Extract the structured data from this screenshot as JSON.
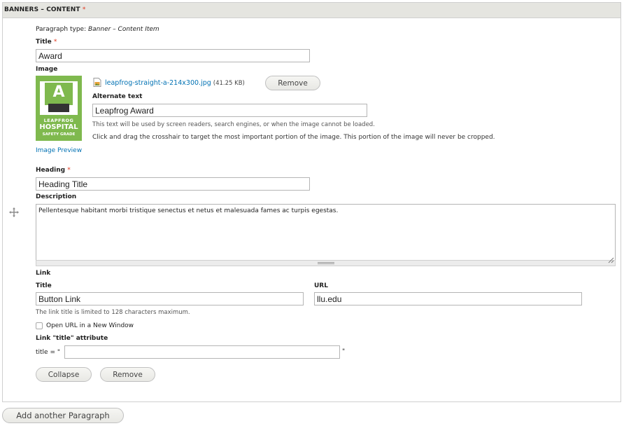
{
  "panel": {
    "title": "BANNERS – CONTENT",
    "required_mark": "*"
  },
  "paragraph_type": {
    "label": "Paragraph type:",
    "value": "Banner – Content Item"
  },
  "title_field": {
    "label": "Title",
    "required_mark": "*",
    "value": "Award"
  },
  "image_field": {
    "label": "Image",
    "file_name": "leapfrog-straight-a-214x300.jpg",
    "file_size": "(41.25 KB)",
    "remove_label": "Remove",
    "thumbnail": {
      "grade": "A",
      "line1": "LEAPFROG",
      "line2": "HOSPITAL",
      "line3": "SAFETY GRADE"
    },
    "alt_label": "Alternate text",
    "alt_value": "Leapfrog Award",
    "alt_help": "This text will be used by screen readers, search engines, or when the image cannot be loaded.",
    "crop_help": "Click and drag the crosshair to target the most important portion of the image. This portion of the image will never be cropped.",
    "preview_link": "Image Preview"
  },
  "heading_field": {
    "label": "Heading",
    "required_mark": "*",
    "value": "Heading Title"
  },
  "description_field": {
    "label": "Description",
    "value": "Pellentesque habitant morbi tristique senectus et netus et malesuada fames ac turpis egestas."
  },
  "link_field": {
    "label": "Link",
    "title_label": "Title",
    "title_value": "Button Link",
    "url_label": "URL",
    "url_value": "llu.edu",
    "title_help": "The link title is limited to 128 characters maximum.",
    "new_window_label": "Open URL in a New Window",
    "attr_label": "Link \"title\" attribute",
    "attr_prefix": "title = \"",
    "attr_suffix": "\"",
    "attr_value": ""
  },
  "actions": {
    "collapse_label": "Collapse",
    "remove_label": "Remove",
    "add_paragraph_label": "Add another Paragraph"
  },
  "colors": {
    "header_bg": "#e5e5e0",
    "required": "#e0341b",
    "link": "#0071b3",
    "leapfrog_green": "#7fb94e"
  },
  "icons": {
    "drag": "move-icon",
    "file": "image-file-icon"
  }
}
